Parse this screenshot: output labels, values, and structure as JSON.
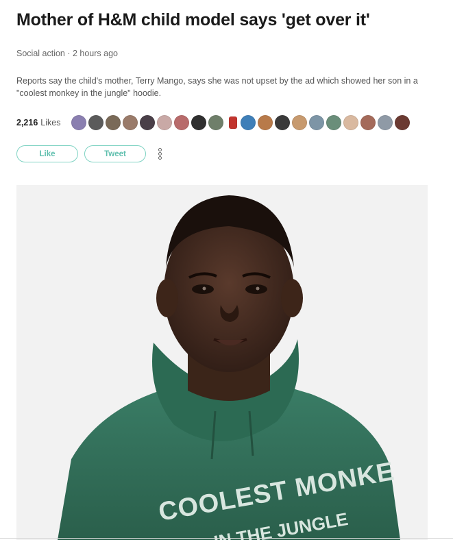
{
  "article": {
    "headline": "Mother of H&M child model says 'get over it'",
    "meta": "Social action · 2 hours ago",
    "summary": "Reports say the child's mother, Terry Mango, says she was not upset by the ad which showed her son in a \"coolest monkey in the jungle\" hoodie."
  },
  "likes": {
    "count": "2,216",
    "label": "Likes",
    "avatars": [
      "#8a7fb0",
      "#5b5b5b",
      "#7a6a58",
      "#9a7b6a",
      "#4a3f48",
      "#c9a9a6",
      "#b86b6b",
      "#2f2f2f",
      "#6f7f6a",
      "#c2352e",
      "#3f7fb8",
      "#b87a4a",
      "#3a3a3a",
      "#c79a6f",
      "#7d95a6",
      "#6a8e7a",
      "#d9b9a0",
      "#a46a5a",
      "#8f9aa6",
      "#6b3a32"
    ]
  },
  "actions": {
    "like_label": "Like",
    "tweet_label": "Tweet"
  },
  "photo": {
    "hoodie_text_line1": "COOLEST MONKE",
    "hoodie_text_line2": "IN THE JUNGLE"
  },
  "colors": {
    "accent": "#5fbfae",
    "hoodie": "#2f6e57",
    "photo_bg": "#f3f3f3"
  }
}
